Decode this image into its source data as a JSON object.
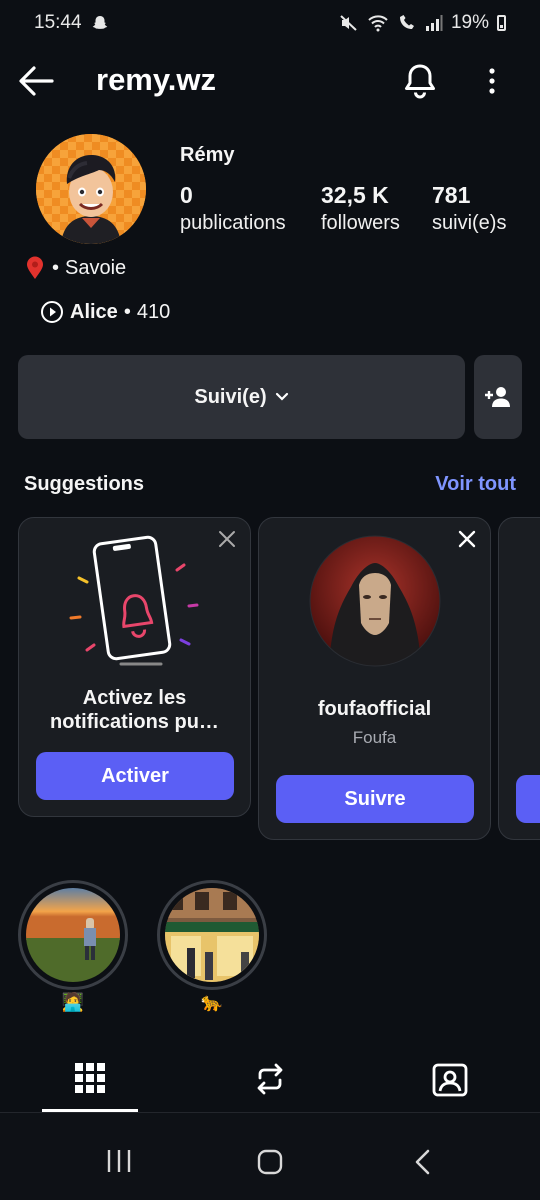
{
  "status_bar": {
    "time": "15:44",
    "battery": "19%"
  },
  "header": {
    "username": "remy.wz",
    "icons": [
      "back-arrow-icon",
      "bell-icon",
      "more-vertical-icon"
    ]
  },
  "profile": {
    "display_name": "Rémy",
    "stats": [
      {
        "value": "0",
        "label": "publications"
      },
      {
        "value": "32,5 K",
        "label": "followers"
      },
      {
        "value": "781",
        "label": "suivi(e)s"
      }
    ],
    "location_prefix": "•",
    "location": "Savoie",
    "music_artist": "Alice",
    "music_separator": "•",
    "music_count": "410"
  },
  "actions": {
    "follow_label": "Suivi(e)",
    "add_user_icon": "add-person-icon"
  },
  "suggestions": {
    "title": "Suggestions",
    "see_all": "Voir tout",
    "cards": [
      {
        "type": "notification",
        "title": "Activez les notifications pu…",
        "button": "Activer"
      },
      {
        "type": "profile",
        "username": "foufaofficial",
        "name": "Foufa",
        "button": "Suivre"
      }
    ]
  },
  "highlights": [
    {
      "label_emoji": "🧑‍💻"
    },
    {
      "label_emoji": "🐆"
    }
  ],
  "tabs": [
    "grid-icon",
    "reposts-icon",
    "tagged-icon"
  ],
  "colors": {
    "background": "#0c0f14",
    "button_gray": "#2e3138",
    "accent_blue": "#5b5ff5",
    "link_blue": "#7f95ff"
  }
}
